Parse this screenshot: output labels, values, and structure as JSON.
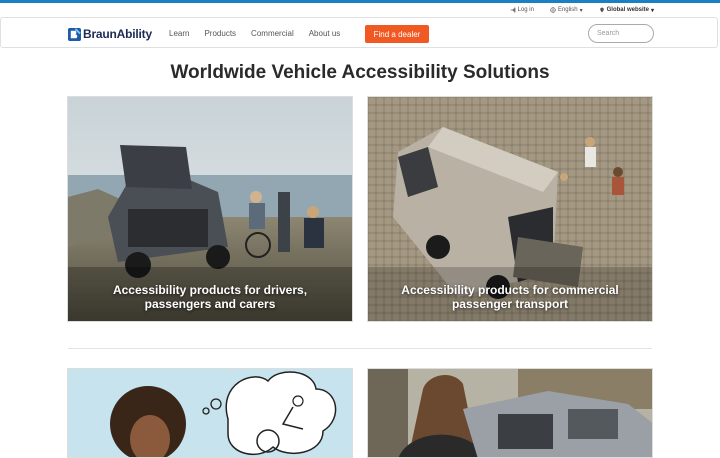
{
  "utility": {
    "login": "Log in",
    "language": "English",
    "region": "Global website"
  },
  "brand": {
    "name": "BraunAbility"
  },
  "nav": {
    "items": [
      "Learn",
      "Products",
      "Commercial",
      "About us"
    ],
    "cta": "Find a dealer",
    "search_placeholder": "Search"
  },
  "page": {
    "title": "Worldwide Vehicle Accessibility Solutions"
  },
  "cards": [
    {
      "caption_line1": "Accessibility products for drivers,",
      "caption_line2": "passengers and carers"
    },
    {
      "caption_line1": "Accessibility products for commercial",
      "caption_line2": "passenger transport"
    }
  ],
  "colors": {
    "accent": "#f05a22",
    "brand": "#1d2a54",
    "stripe": "#1b7fc0"
  }
}
